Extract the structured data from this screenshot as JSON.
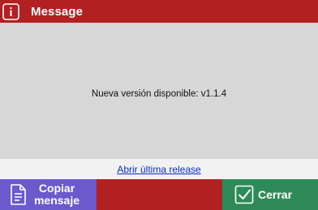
{
  "window": {
    "title": "Message",
    "title_icon": "info-icon"
  },
  "message": {
    "text": "Nueva versión disponible: v1.1.4"
  },
  "link": {
    "label": "Abrir última release"
  },
  "buttons": {
    "copy": {
      "line1": "Copiar",
      "line2": "mensaje",
      "icon": "document-icon"
    },
    "close": {
      "label": "Cerrar",
      "icon": "checkbox-check-icon"
    }
  },
  "colors": {
    "title_bar": "#b32022",
    "copy_button": "#6a5acd",
    "close_button": "#2e8b57",
    "link": "#0a2ec8"
  }
}
